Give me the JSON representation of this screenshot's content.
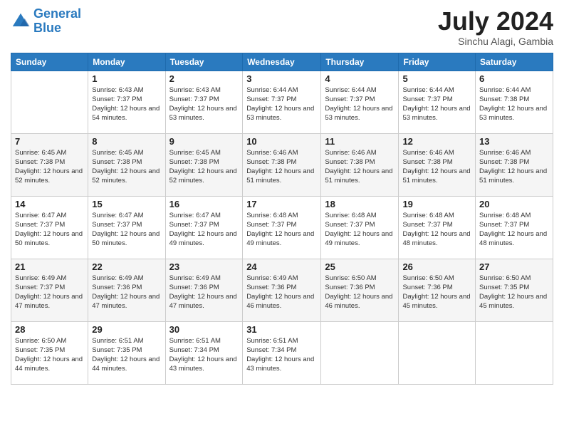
{
  "logo": {
    "line1": "General",
    "line2": "Blue"
  },
  "title": "July 2024",
  "location": "Sinchu Alagi, Gambia",
  "days_of_week": [
    "Sunday",
    "Monday",
    "Tuesday",
    "Wednesday",
    "Thursday",
    "Friday",
    "Saturday"
  ],
  "weeks": [
    [
      {
        "day": "",
        "sunrise": "",
        "sunset": "",
        "daylight": ""
      },
      {
        "day": "1",
        "sunrise": "Sunrise: 6:43 AM",
        "sunset": "Sunset: 7:37 PM",
        "daylight": "Daylight: 12 hours and 54 minutes."
      },
      {
        "day": "2",
        "sunrise": "Sunrise: 6:43 AM",
        "sunset": "Sunset: 7:37 PM",
        "daylight": "Daylight: 12 hours and 53 minutes."
      },
      {
        "day": "3",
        "sunrise": "Sunrise: 6:44 AM",
        "sunset": "Sunset: 7:37 PM",
        "daylight": "Daylight: 12 hours and 53 minutes."
      },
      {
        "day": "4",
        "sunrise": "Sunrise: 6:44 AM",
        "sunset": "Sunset: 7:37 PM",
        "daylight": "Daylight: 12 hours and 53 minutes."
      },
      {
        "day": "5",
        "sunrise": "Sunrise: 6:44 AM",
        "sunset": "Sunset: 7:37 PM",
        "daylight": "Daylight: 12 hours and 53 minutes."
      },
      {
        "day": "6",
        "sunrise": "Sunrise: 6:44 AM",
        "sunset": "Sunset: 7:38 PM",
        "daylight": "Daylight: 12 hours and 53 minutes."
      }
    ],
    [
      {
        "day": "7",
        "sunrise": "Sunrise: 6:45 AM",
        "sunset": "Sunset: 7:38 PM",
        "daylight": "Daylight: 12 hours and 52 minutes."
      },
      {
        "day": "8",
        "sunrise": "Sunrise: 6:45 AM",
        "sunset": "Sunset: 7:38 PM",
        "daylight": "Daylight: 12 hours and 52 minutes."
      },
      {
        "day": "9",
        "sunrise": "Sunrise: 6:45 AM",
        "sunset": "Sunset: 7:38 PM",
        "daylight": "Daylight: 12 hours and 52 minutes."
      },
      {
        "day": "10",
        "sunrise": "Sunrise: 6:46 AM",
        "sunset": "Sunset: 7:38 PM",
        "daylight": "Daylight: 12 hours and 51 minutes."
      },
      {
        "day": "11",
        "sunrise": "Sunrise: 6:46 AM",
        "sunset": "Sunset: 7:38 PM",
        "daylight": "Daylight: 12 hours and 51 minutes."
      },
      {
        "day": "12",
        "sunrise": "Sunrise: 6:46 AM",
        "sunset": "Sunset: 7:38 PM",
        "daylight": "Daylight: 12 hours and 51 minutes."
      },
      {
        "day": "13",
        "sunrise": "Sunrise: 6:46 AM",
        "sunset": "Sunset: 7:38 PM",
        "daylight": "Daylight: 12 hours and 51 minutes."
      }
    ],
    [
      {
        "day": "14",
        "sunrise": "Sunrise: 6:47 AM",
        "sunset": "Sunset: 7:37 PM",
        "daylight": "Daylight: 12 hours and 50 minutes."
      },
      {
        "day": "15",
        "sunrise": "Sunrise: 6:47 AM",
        "sunset": "Sunset: 7:37 PM",
        "daylight": "Daylight: 12 hours and 50 minutes."
      },
      {
        "day": "16",
        "sunrise": "Sunrise: 6:47 AM",
        "sunset": "Sunset: 7:37 PM",
        "daylight": "Daylight: 12 hours and 49 minutes."
      },
      {
        "day": "17",
        "sunrise": "Sunrise: 6:48 AM",
        "sunset": "Sunset: 7:37 PM",
        "daylight": "Daylight: 12 hours and 49 minutes."
      },
      {
        "day": "18",
        "sunrise": "Sunrise: 6:48 AM",
        "sunset": "Sunset: 7:37 PM",
        "daylight": "Daylight: 12 hours and 49 minutes."
      },
      {
        "day": "19",
        "sunrise": "Sunrise: 6:48 AM",
        "sunset": "Sunset: 7:37 PM",
        "daylight": "Daylight: 12 hours and 48 minutes."
      },
      {
        "day": "20",
        "sunrise": "Sunrise: 6:48 AM",
        "sunset": "Sunset: 7:37 PM",
        "daylight": "Daylight: 12 hours and 48 minutes."
      }
    ],
    [
      {
        "day": "21",
        "sunrise": "Sunrise: 6:49 AM",
        "sunset": "Sunset: 7:37 PM",
        "daylight": "Daylight: 12 hours and 47 minutes."
      },
      {
        "day": "22",
        "sunrise": "Sunrise: 6:49 AM",
        "sunset": "Sunset: 7:36 PM",
        "daylight": "Daylight: 12 hours and 47 minutes."
      },
      {
        "day": "23",
        "sunrise": "Sunrise: 6:49 AM",
        "sunset": "Sunset: 7:36 PM",
        "daylight": "Daylight: 12 hours and 47 minutes."
      },
      {
        "day": "24",
        "sunrise": "Sunrise: 6:49 AM",
        "sunset": "Sunset: 7:36 PM",
        "daylight": "Daylight: 12 hours and 46 minutes."
      },
      {
        "day": "25",
        "sunrise": "Sunrise: 6:50 AM",
        "sunset": "Sunset: 7:36 PM",
        "daylight": "Daylight: 12 hours and 46 minutes."
      },
      {
        "day": "26",
        "sunrise": "Sunrise: 6:50 AM",
        "sunset": "Sunset: 7:36 PM",
        "daylight": "Daylight: 12 hours and 45 minutes."
      },
      {
        "day": "27",
        "sunrise": "Sunrise: 6:50 AM",
        "sunset": "Sunset: 7:35 PM",
        "daylight": "Daylight: 12 hours and 45 minutes."
      }
    ],
    [
      {
        "day": "28",
        "sunrise": "Sunrise: 6:50 AM",
        "sunset": "Sunset: 7:35 PM",
        "daylight": "Daylight: 12 hours and 44 minutes."
      },
      {
        "day": "29",
        "sunrise": "Sunrise: 6:51 AM",
        "sunset": "Sunset: 7:35 PM",
        "daylight": "Daylight: 12 hours and 44 minutes."
      },
      {
        "day": "30",
        "sunrise": "Sunrise: 6:51 AM",
        "sunset": "Sunset: 7:34 PM",
        "daylight": "Daylight: 12 hours and 43 minutes."
      },
      {
        "day": "31",
        "sunrise": "Sunrise: 6:51 AM",
        "sunset": "Sunset: 7:34 PM",
        "daylight": "Daylight: 12 hours and 43 minutes."
      },
      {
        "day": "",
        "sunrise": "",
        "sunset": "",
        "daylight": ""
      },
      {
        "day": "",
        "sunrise": "",
        "sunset": "",
        "daylight": ""
      },
      {
        "day": "",
        "sunrise": "",
        "sunset": "",
        "daylight": ""
      }
    ]
  ]
}
